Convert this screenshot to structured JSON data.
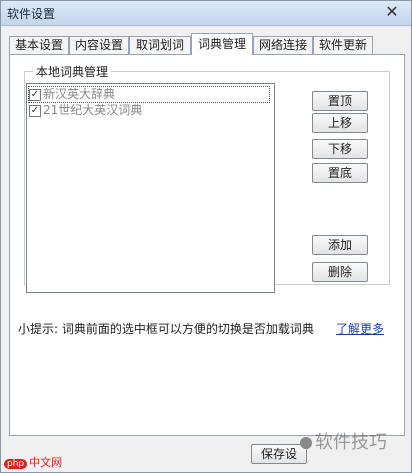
{
  "window": {
    "title": "软件设置"
  },
  "tabs": [
    {
      "label": "基本设置"
    },
    {
      "label": "内容设置"
    },
    {
      "label": "取词划词"
    },
    {
      "label": "词典管理"
    },
    {
      "label": "网络连接"
    },
    {
      "label": "软件更新"
    }
  ],
  "active_tab": "词典管理",
  "group": {
    "label": "本地词典管理"
  },
  "dictionaries": [
    {
      "name": "新汉英大辞典",
      "checked": true
    },
    {
      "name": "21世纪大英汉词典",
      "checked": true
    }
  ],
  "buttons": {
    "top": "置顶",
    "up": "上移",
    "down": "下移",
    "bottom": "置底",
    "add": "添加",
    "delete": "删除"
  },
  "hint": {
    "text": "小提示: 词典前面的选中框可以方便的切换是否加载词典",
    "link": "了解更多"
  },
  "save_button": "保存设",
  "watermark": {
    "right": "软件技巧",
    "left_badge": "php",
    "left_text": "中文网"
  }
}
